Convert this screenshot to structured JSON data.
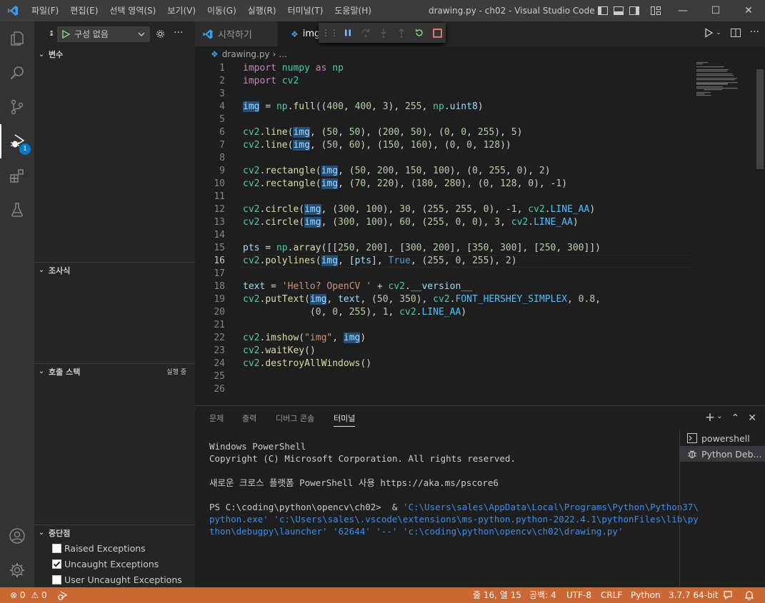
{
  "window": {
    "title": "drawing.py - ch02 - Visual Studio Code",
    "menu": [
      "파일(F)",
      "편집(E)",
      "선택 영역(S)",
      "보기(V)",
      "이동(G)",
      "실행(R)",
      "터미널(T)",
      "도움말(H)"
    ]
  },
  "activity": {
    "debug_badge": "1"
  },
  "sidebar": {
    "config_label": "구성 없음",
    "variables_title": "변수",
    "watch_title": "조사식",
    "callstack_title": "호출 스택",
    "callstack_status": "실행 중",
    "breakpoints_title": "중단점",
    "breakpoints": [
      {
        "label": "Raised Exceptions",
        "checked": false
      },
      {
        "label": "Uncaught Exceptions",
        "checked": true
      },
      {
        "label": "User Uncaught Exceptions",
        "checked": false
      }
    ]
  },
  "tabs": [
    {
      "label": "시작하기"
    },
    {
      "label": "img"
    }
  ],
  "breadcrumb": {
    "file": "drawing.py",
    "more": "..."
  },
  "editor": {
    "current_line": 16,
    "lines": [
      "import numpy as np",
      "import cv2",
      "",
      "img = np.full((400, 400, 3), 255, np.uint8)",
      "",
      "cv2.line(img, (50, 50), (200, 50), (0, 0, 255), 5)",
      "cv2.line(img, (50, 60), (150, 160), (0, 0, 128))",
      "",
      "cv2.rectangle(img, (50, 200, 150, 100), (0, 255, 0), 2)",
      "cv2.rectangle(img, (70, 220), (180, 280), (0, 128, 0), -1)",
      "",
      "cv2.circle(img, (300, 100), 30, (255, 255, 0), -1, cv2.LINE_AA)",
      "cv2.circle(img, (300, 100), 60, (255, 0, 0), 3, cv2.LINE_AA)",
      "",
      "pts = np.array([[250, 200], [300, 200], [350, 300], [250, 300]])",
      "cv2.polylines(img, [pts], True, (255, 0, 255), 2)",
      "",
      "text = 'Hello? OpenCV ' + cv2.__version__",
      "cv2.putText(img, text, (50, 350), cv2.FONT_HERSHEY_SIMPLEX, 0.8,",
      "            (0, 0, 255), 1, cv2.LINE_AA)",
      "",
      "cv2.imshow(\"img\", img)",
      "cv2.waitKey()",
      "cv2.destroyAllWindows()",
      "",
      ""
    ]
  },
  "panel": {
    "tabs": [
      "문제",
      "출력",
      "디버그 콘솔",
      "터미널"
    ],
    "active_tab": "터미널",
    "terminal_lines": [
      {
        "text": "Windows PowerShell",
        "style": "plain"
      },
      {
        "text": "Copyright (C) Microsoft Corporation. All rights reserved.",
        "style": "plain"
      },
      {
        "text": "",
        "style": "plain"
      },
      {
        "text": "새로운 크로스 플랫폼 PowerShell 사용 https://aka.ms/pscore6",
        "style": "plain"
      },
      {
        "text": "",
        "style": "plain"
      },
      {
        "text": "PS C:\\coding\\python\\opencv\\ch02>  & 'C:\\Users\\sales\\AppData\\Local\\Programs\\Python\\Python37\\",
        "style": "prompt"
      },
      {
        "text": "python.exe' 'c:\\Users\\sales\\.vscode\\extensions\\ms-python.python-2022.4.1\\pythonFiles\\lib\\py",
        "style": "blue"
      },
      {
        "text": "thon\\debugpy\\launcher' '62644' '--' 'c:\\coding\\python\\opencv\\ch02\\drawing.py'",
        "style": "blue"
      }
    ],
    "prompt_prefix": "PS C:\\coding\\python\\opencv\\ch02>  & ",
    "prompt_rest": "'C:\\Users\\sales\\AppData\\Local\\Programs\\Python\\Python37\\",
    "terminals": [
      {
        "label": "powershell",
        "icon": "terminal-icon"
      },
      {
        "label": "Python Deb...",
        "icon": "debug-icon"
      }
    ]
  },
  "statusbar": {
    "errors": "0",
    "warnings": "0",
    "position": "줄 16, 열 15",
    "spaces": "공백: 4",
    "encoding": "UTF-8",
    "eol": "CRLF",
    "language": "Python",
    "interpreter": "3.7.7 64-bit",
    "color": "#cc6633"
  }
}
